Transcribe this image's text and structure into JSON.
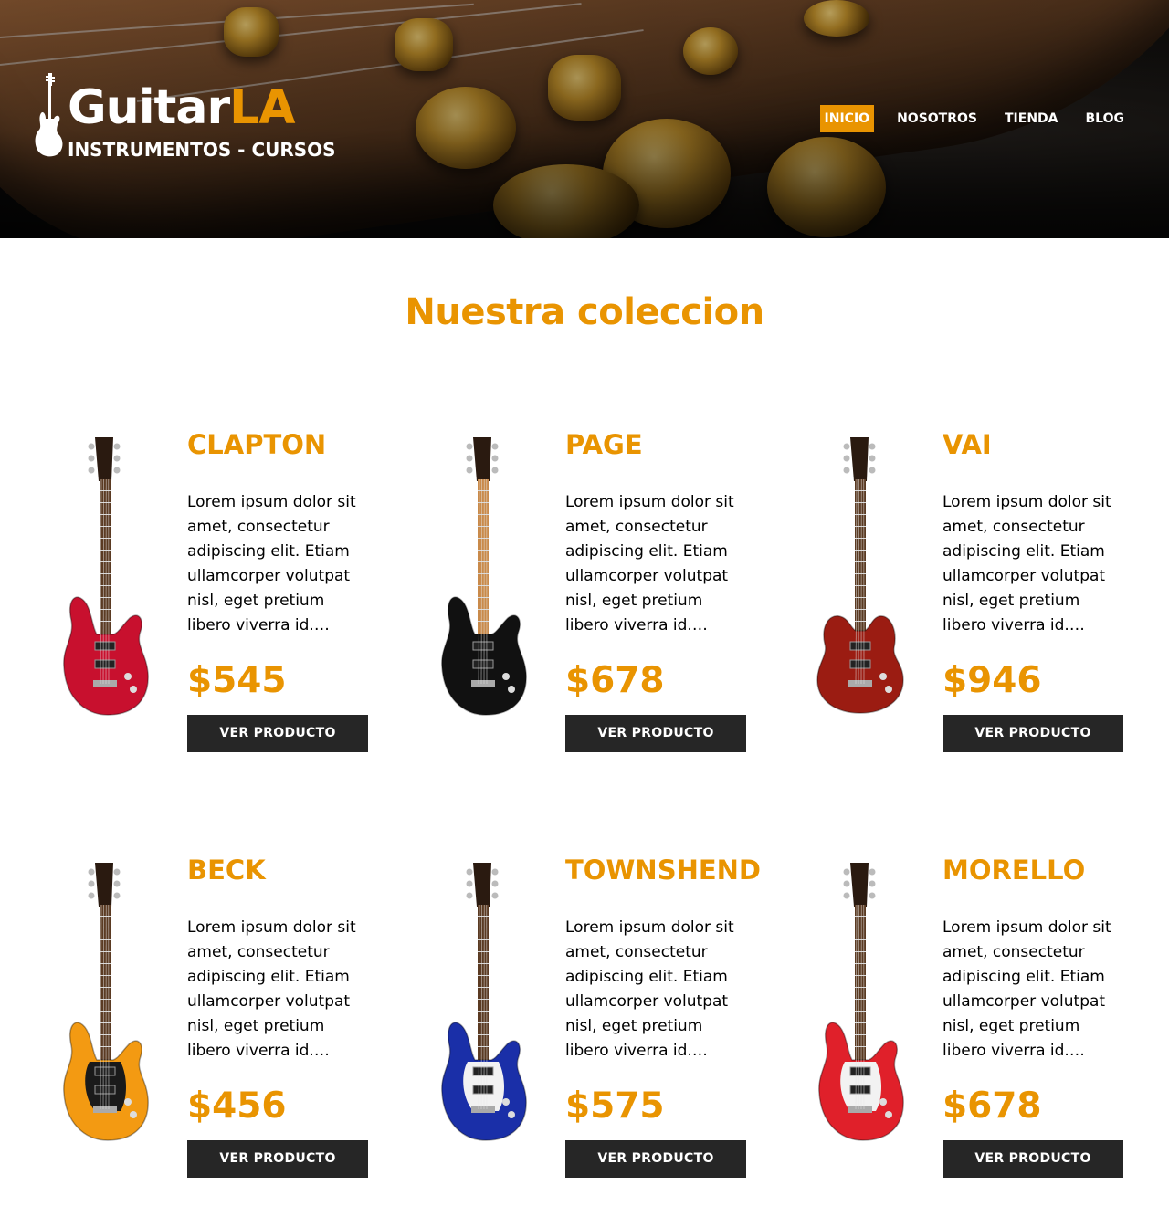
{
  "brand": {
    "name_part1": "Guitar",
    "name_part2": "LA",
    "tagline": "INSTRUMENTOS - CURSOS",
    "accent_color": "#e99401",
    "dark_color": "#262626"
  },
  "nav": {
    "items": [
      {
        "label": "INICIO",
        "active": true
      },
      {
        "label": "NOSOTROS",
        "active": false
      },
      {
        "label": "TIENDA",
        "active": false
      },
      {
        "label": "BLOG",
        "active": false
      }
    ]
  },
  "main": {
    "heading": "Nuestra coleccion",
    "button_label": "VER PRODUCTO",
    "products": [
      {
        "name": "CLAPTON",
        "description": "Lorem ipsum dolor sit amet, consectetur adipiscing elit. Etiam ullamcorper volutpat nisl, eget pretium libero viverra id. Maecenas u...",
        "price": "$545",
        "body_color": "#c8102e",
        "icon": "red-quilted-guitar-icon"
      },
      {
        "name": "PAGE",
        "description": "Lorem ipsum dolor sit amet, consectetur adipiscing elit. Etiam ullamcorper volutpat nisl, eget pretium libero viverra id. Maecenas u...",
        "price": "$678",
        "body_color": "#111111",
        "icon": "black-guitar-icon"
      },
      {
        "name": "VAI",
        "description": "Lorem ipsum dolor sit amet, consectetur adipiscing elit. Etiam ullamcorper volutpat nisl, eget pretium libero viverra id. Maecenas u...",
        "price": "$946",
        "body_color": "#9b1c12",
        "icon": "cherry-single-cut-guitar-icon"
      },
      {
        "name": "BECK",
        "description": "Lorem ipsum dolor sit amet, consectetur adipiscing elit. Etiam ullamcorper volutpat nisl, eget pretium libero viverra id. Maecenas u...",
        "price": "$456",
        "body_color": "#f39a12",
        "icon": "orange-guitar-icon"
      },
      {
        "name": "TOWNSHEND",
        "description": "Lorem ipsum dolor sit amet, consectetur adipiscing elit. Etiam ullamcorper volutpat nisl, eget pretium libero viverra id. Maecenas u...",
        "price": "$575",
        "body_color": "#1a2fa8",
        "icon": "blue-guitar-icon"
      },
      {
        "name": "MORELLO",
        "description": "Lorem ipsum dolor sit amet, consectetur adipiscing elit. Etiam ullamcorper volutpat nisl, eget pretium libero viverra id. Maecenas u...",
        "price": "$678",
        "body_color": "#e0202a",
        "icon": "red-white-guitar-icon"
      }
    ]
  }
}
